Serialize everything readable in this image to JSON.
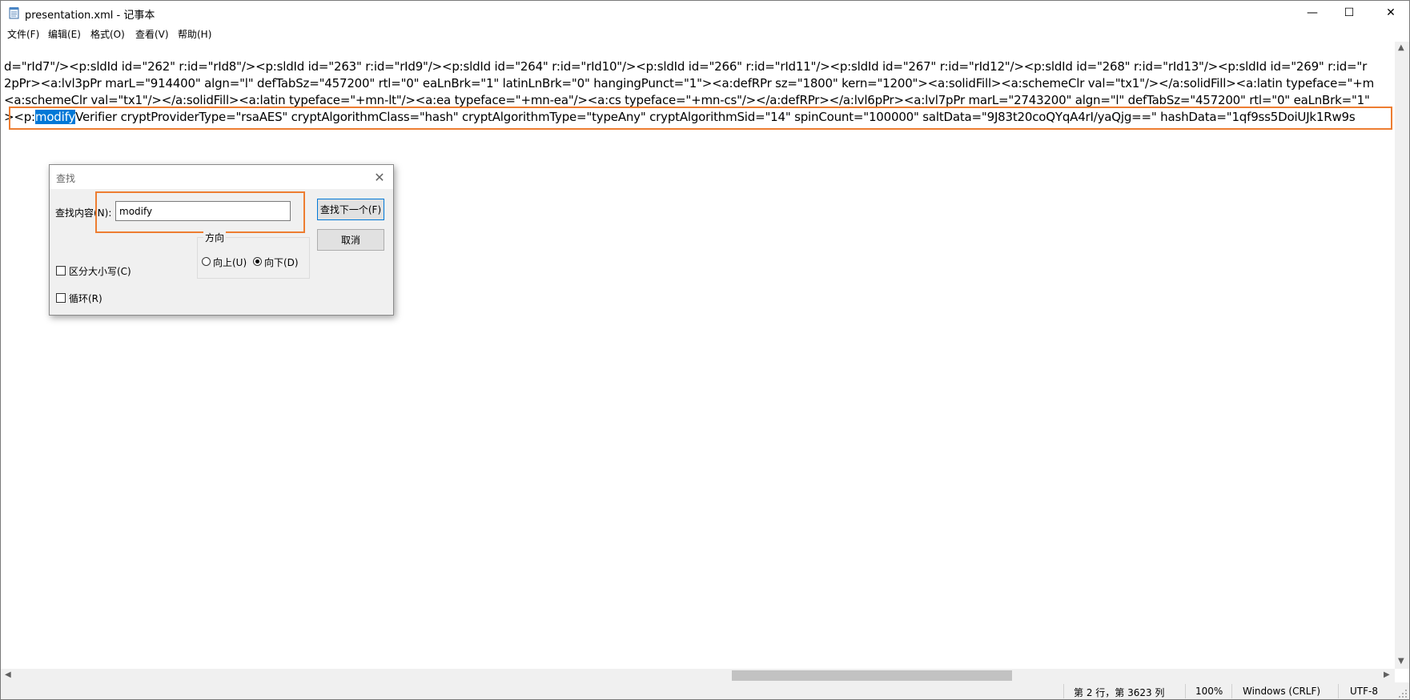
{
  "window": {
    "title": "presentation.xml - 记事本",
    "icon": "notepad-icon",
    "controls": {
      "minimize": "—",
      "maximize": "☐",
      "close": "✕"
    }
  },
  "menu": [
    {
      "label": "文件(F)"
    },
    {
      "label": "编辑(E)"
    },
    {
      "label": "格式(O)"
    },
    {
      "label": "查看(V)"
    },
    {
      "label": "帮助(H)"
    }
  ],
  "editor": {
    "lines": [
      "d=\"rId7\"/><p:sldId id=\"262\" r:id=\"rId8\"/><p:sldId id=\"263\" r:id=\"rId9\"/><p:sldId id=\"264\" r:id=\"rId10\"/><p:sldId id=\"266\" r:id=\"rId11\"/><p:sldId id=\"267\" r:id=\"rId12\"/><p:sldId id=\"268\" r:id=\"rId13\"/><p:sldId id=\"269\" r:id=\"r",
      "2pPr><a:lvl3pPr marL=\"914400\" algn=\"l\" defTabSz=\"457200\" rtl=\"0\" eaLnBrk=\"1\" latinLnBrk=\"0\" hangingPunct=\"1\"><a:defRPr sz=\"1800\" kern=\"1200\"><a:solidFill><a:schemeClr val=\"tx1\"/></a:solidFill><a:latin typeface=\"+m",
      "<a:schemeClr val=\"tx1\"/></a:solidFill><a:latin typeface=\"+mn-lt\"/><a:ea typeface=\"+mn-ea\"/><a:cs typeface=\"+mn-cs\"/></a:defRPr></a:lvl6pPr><a:lvl7pPr marL=\"2743200\" algn=\"l\" defTabSz=\"457200\" rtl=\"0\" eaLnBrk=\"1\""
    ],
    "line4_prefix": "><p:",
    "line4_match": "modify",
    "line4_suffix": "Verifier cryptProviderType=\"rsaAES\" cryptAlgorithmClass=\"hash\" cryptAlgorithmType=\"typeAny\" cryptAlgorithmSid=\"14\" spinCount=\"100000\" saltData=\"9J83t20coQYqA4rI/yaQjg==\" hashData=\"1qf9ss5DoiUJk1Rw9s"
  },
  "find_dialog": {
    "title": "查找",
    "find_label": "查找内容(N):",
    "find_value": "modify",
    "find_next_button": "查找下一个(F)",
    "cancel_button": "取消",
    "direction_label": "方向",
    "up_label": "向上(U)",
    "down_label": "向下(D)",
    "direction_selected": "down",
    "match_case_label": "区分大小写(C)",
    "match_case_checked": false,
    "wrap_label": "循环(R)",
    "wrap_checked": false,
    "close_icon": "close-icon"
  },
  "status": {
    "position": "第 2 行，第 3623 列",
    "zoom": "100%",
    "line_ending": "Windows (CRLF)",
    "encoding": "UTF-8"
  },
  "scroll": {
    "horizontal_fraction": 0.52
  }
}
